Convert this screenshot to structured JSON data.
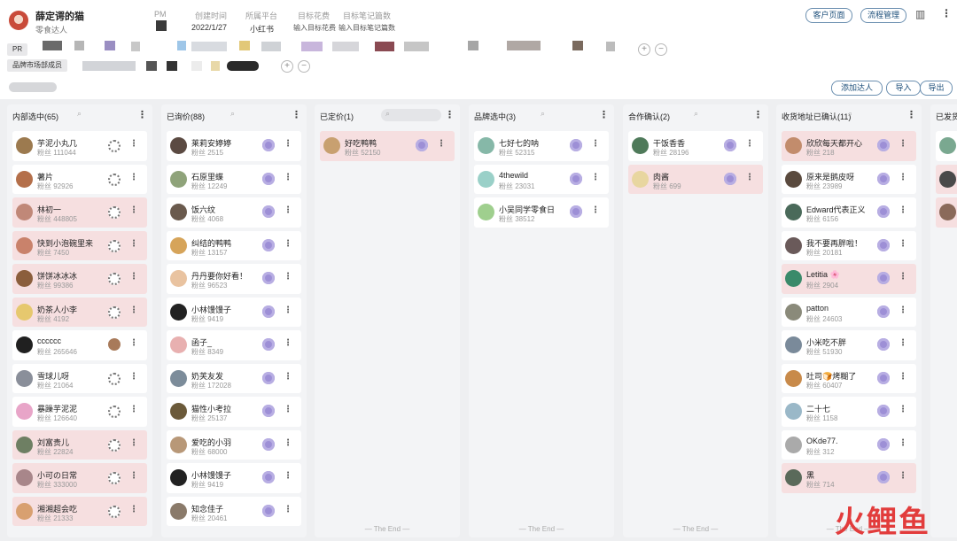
{
  "colors": {
    "accent": "#1d4f7a",
    "highlight_card": "#f6dfe0",
    "badge": "#9d8fd6",
    "watermark": "#e23c3c"
  },
  "project": {
    "title": "薛定谔的猫",
    "subtitle": "零食达人",
    "logo": "cat-logo-icon"
  },
  "meta": [
    {
      "label": "PM",
      "value": ""
    },
    {
      "label": "创建时间",
      "value": "2022/1/27"
    },
    {
      "label": "所属平台",
      "value": "小红书"
    },
    {
      "label": "目标花费",
      "value": "输入目标花费"
    },
    {
      "label": "目标笔记篇数",
      "value": "输入目标笔记篇数"
    }
  ],
  "header_buttons": {
    "customer_page": "客户页面",
    "process_mgmt": "流程管理"
  },
  "header_icons": {
    "chart": "bar-chart-icon",
    "more": "more-vertical-icon"
  },
  "tags": {
    "pr": "PR",
    "brand_members": "品牌市场部成员"
  },
  "toolbar": {
    "add_kol": "添加达人",
    "import": "导入",
    "export": "导出"
  },
  "fans_label": "粉丝",
  "end_text": "The End",
  "columns": [
    {
      "title": "内部选中(65)",
      "badge": "cog",
      "end": false,
      "cards": [
        {
          "name": "芋泥小丸几",
          "fans": "111044",
          "hl": false,
          "avatar": "#9c7a4f"
        },
        {
          "name": "薯片",
          "fans": "92926",
          "hl": false,
          "avatar": "#b46f4a"
        },
        {
          "name": "林初一",
          "fans": "448805",
          "hl": true,
          "avatar": "#c08878"
        },
        {
          "name": "快到小泡碗里来",
          "fans": "7450",
          "hl": true,
          "avatar": "#c9826b"
        },
        {
          "name": "饼饼冰冰冰",
          "fans": "99386",
          "hl": true,
          "avatar": "#8b5e3c"
        },
        {
          "name": "奶茶人小李",
          "fans": "4192",
          "hl": true,
          "avatar": "#e6c86e"
        },
        {
          "name": "cccccc",
          "fans": "265646",
          "hl": false,
          "avatar": "#202020",
          "badge": "photo"
        },
        {
          "name": "雪球儿呀",
          "fans": "21064",
          "hl": false,
          "avatar": "#8a8f9a"
        },
        {
          "name": "暴躁芋泥泥",
          "fans": "126640",
          "hl": false,
          "avatar": "#e8a5c8"
        },
        {
          "name": "刘富贵儿",
          "fans": "22824",
          "hl": true,
          "avatar": "#6e7f63"
        },
        {
          "name": "小可の日常",
          "fans": "333000",
          "hl": true,
          "avatar": "#a8868a"
        },
        {
          "name": "湘湘超会吃",
          "fans": "21333",
          "hl": true,
          "avatar": "#d8a070"
        }
      ]
    },
    {
      "title": "已询价(88)",
      "badge": "purple",
      "end": false,
      "cards": [
        {
          "name": "莱莉安婷婷",
          "fans": "2515",
          "hl": false,
          "avatar": "#5b4a42"
        },
        {
          "name": "石原里蝶",
          "fans": "12249",
          "hl": false,
          "avatar": "#8fa37a"
        },
        {
          "name": "饭六纹",
          "fans": "4068",
          "hl": false,
          "avatar": "#6a5a4d"
        },
        {
          "name": "纠结的鸭鸭",
          "fans": "13157",
          "hl": false,
          "avatar": "#d6a45a"
        },
        {
          "name": "丹丹要你好看！",
          "fans": "96523",
          "hl": false,
          "avatar": "#e9c3a0"
        },
        {
          "name": "小林馒馒子",
          "fans": "9419",
          "hl": false,
          "avatar": "#222222"
        },
        {
          "name": "函子_",
          "fans": "8349",
          "hl": false,
          "avatar": "#e8b0b0"
        },
        {
          "name": "奶芙友发",
          "fans": "172028",
          "hl": false,
          "avatar": "#7c8c9a"
        },
        {
          "name": "猫性小考拉",
          "fans": "25137",
          "hl": false,
          "avatar": "#6b5a3a"
        },
        {
          "name": "爱吃的小羽",
          "fans": "68000",
          "hl": false,
          "avatar": "#b89878"
        },
        {
          "name": "小林馒馒子",
          "fans": "9419",
          "hl": false,
          "avatar": "#222222"
        },
        {
          "name": "知念佳子",
          "fans": "20461",
          "hl": false,
          "avatar": "#8a7a6a"
        }
      ]
    },
    {
      "title": "已定价(1)",
      "badge": "purple",
      "end": true,
      "cards": [
        {
          "name": "好吃鸭鸭",
          "fans": "52150",
          "hl": true,
          "avatar": "#c8a070"
        }
      ]
    },
    {
      "title": "品牌选中(3)",
      "badge": "purple",
      "end": true,
      "cards": [
        {
          "name": "七好七的呐",
          "fans": "52315",
          "hl": false,
          "avatar": "#86b8a8"
        },
        {
          "name": "4thewild",
          "fans": "23031",
          "hl": false,
          "avatar": "#9ad0c8"
        },
        {
          "name": "小吴同学零食日",
          "fans": "38512",
          "hl": false,
          "avatar": "#9fcf8e"
        }
      ]
    },
    {
      "title": "合作确认(2)",
      "badge": "purple",
      "end": true,
      "cards": [
        {
          "name": "干饭香香",
          "fans": "28196",
          "hl": false,
          "avatar": "#4f7a5a"
        },
        {
          "name": "肉酱",
          "fans": "699",
          "hl": true,
          "avatar": "#e8d6a0"
        }
      ]
    },
    {
      "title": "收货地址已确认(11)",
      "badge": "purple",
      "end": true,
      "cards": [
        {
          "name": "欣欣每天都开心",
          "fans": "218",
          "hl": true,
          "avatar": "#c28c6c"
        },
        {
          "name": "原来是鹅皮呀",
          "fans": "23989",
          "hl": false,
          "avatar": "#5a4a3e"
        },
        {
          "name": "Edward代表正义",
          "fans": "6156",
          "hl": false,
          "avatar": "#4a6a5a"
        },
        {
          "name": "我不要再胖啦！",
          "fans": "20181",
          "hl": false,
          "avatar": "#6a5a5a"
        },
        {
          "name": "Letitia 🌸",
          "fans": "2904",
          "hl": true,
          "avatar": "#3a8a6a"
        },
        {
          "name": "patton",
          "fans": "24603",
          "hl": false,
          "avatar": "#8a8a7a"
        },
        {
          "name": "小米吃不胖",
          "fans": "51930",
          "hl": false,
          "avatar": "#7a8a9a"
        },
        {
          "name": "吐司🍞烤糊了",
          "fans": "60407",
          "hl": false,
          "avatar": "#c88a4a"
        },
        {
          "name": "二十七",
          "fans": "1158",
          "hl": false,
          "avatar": "#9ab8c8"
        },
        {
          "name": "OKde77.",
          "fans": "312",
          "hl": false,
          "avatar": "#aaaaaa"
        },
        {
          "name": "黑",
          "fans": "714",
          "hl": true,
          "avatar": "#5a6a5a"
        }
      ]
    },
    {
      "title": "已发货",
      "badge": "purple",
      "end": true,
      "cards": [
        {
          "name": "",
          "fans": "",
          "hl": false,
          "avatar": "#7aa890"
        },
        {
          "name": "",
          "fans": "",
          "hl": true,
          "avatar": "#4a4a4a"
        },
        {
          "name": "",
          "fans": "",
          "hl": true,
          "avatar": "#8a6a5a"
        }
      ]
    }
  ],
  "watermark": "火鲤鱼"
}
